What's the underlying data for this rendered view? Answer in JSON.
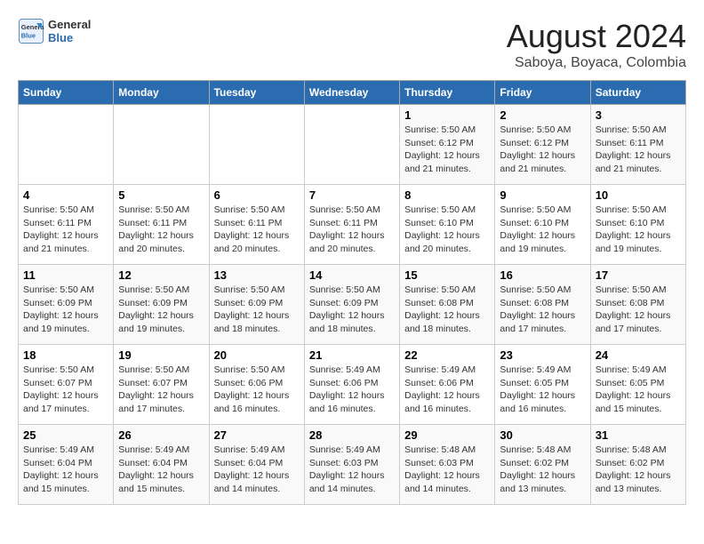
{
  "logo": {
    "line1": "General",
    "line2": "Blue"
  },
  "title": "August 2024",
  "subtitle": "Saboya, Boyaca, Colombia",
  "days_of_week": [
    "Sunday",
    "Monday",
    "Tuesday",
    "Wednesday",
    "Thursday",
    "Friday",
    "Saturday"
  ],
  "weeks": [
    [
      {
        "day": "",
        "info": ""
      },
      {
        "day": "",
        "info": ""
      },
      {
        "day": "",
        "info": ""
      },
      {
        "day": "",
        "info": ""
      },
      {
        "day": "1",
        "info": "Sunrise: 5:50 AM\nSunset: 6:12 PM\nDaylight: 12 hours\nand 21 minutes."
      },
      {
        "day": "2",
        "info": "Sunrise: 5:50 AM\nSunset: 6:12 PM\nDaylight: 12 hours\nand 21 minutes."
      },
      {
        "day": "3",
        "info": "Sunrise: 5:50 AM\nSunset: 6:11 PM\nDaylight: 12 hours\nand 21 minutes."
      }
    ],
    [
      {
        "day": "4",
        "info": "Sunrise: 5:50 AM\nSunset: 6:11 PM\nDaylight: 12 hours\nand 21 minutes."
      },
      {
        "day": "5",
        "info": "Sunrise: 5:50 AM\nSunset: 6:11 PM\nDaylight: 12 hours\nand 20 minutes."
      },
      {
        "day": "6",
        "info": "Sunrise: 5:50 AM\nSunset: 6:11 PM\nDaylight: 12 hours\nand 20 minutes."
      },
      {
        "day": "7",
        "info": "Sunrise: 5:50 AM\nSunset: 6:11 PM\nDaylight: 12 hours\nand 20 minutes."
      },
      {
        "day": "8",
        "info": "Sunrise: 5:50 AM\nSunset: 6:10 PM\nDaylight: 12 hours\nand 20 minutes."
      },
      {
        "day": "9",
        "info": "Sunrise: 5:50 AM\nSunset: 6:10 PM\nDaylight: 12 hours\nand 19 minutes."
      },
      {
        "day": "10",
        "info": "Sunrise: 5:50 AM\nSunset: 6:10 PM\nDaylight: 12 hours\nand 19 minutes."
      }
    ],
    [
      {
        "day": "11",
        "info": "Sunrise: 5:50 AM\nSunset: 6:09 PM\nDaylight: 12 hours\nand 19 minutes."
      },
      {
        "day": "12",
        "info": "Sunrise: 5:50 AM\nSunset: 6:09 PM\nDaylight: 12 hours\nand 19 minutes."
      },
      {
        "day": "13",
        "info": "Sunrise: 5:50 AM\nSunset: 6:09 PM\nDaylight: 12 hours\nand 18 minutes."
      },
      {
        "day": "14",
        "info": "Sunrise: 5:50 AM\nSunset: 6:09 PM\nDaylight: 12 hours\nand 18 minutes."
      },
      {
        "day": "15",
        "info": "Sunrise: 5:50 AM\nSunset: 6:08 PM\nDaylight: 12 hours\nand 18 minutes."
      },
      {
        "day": "16",
        "info": "Sunrise: 5:50 AM\nSunset: 6:08 PM\nDaylight: 12 hours\nand 17 minutes."
      },
      {
        "day": "17",
        "info": "Sunrise: 5:50 AM\nSunset: 6:08 PM\nDaylight: 12 hours\nand 17 minutes."
      }
    ],
    [
      {
        "day": "18",
        "info": "Sunrise: 5:50 AM\nSunset: 6:07 PM\nDaylight: 12 hours\nand 17 minutes."
      },
      {
        "day": "19",
        "info": "Sunrise: 5:50 AM\nSunset: 6:07 PM\nDaylight: 12 hours\nand 17 minutes."
      },
      {
        "day": "20",
        "info": "Sunrise: 5:50 AM\nSunset: 6:06 PM\nDaylight: 12 hours\nand 16 minutes."
      },
      {
        "day": "21",
        "info": "Sunrise: 5:49 AM\nSunset: 6:06 PM\nDaylight: 12 hours\nand 16 minutes."
      },
      {
        "day": "22",
        "info": "Sunrise: 5:49 AM\nSunset: 6:06 PM\nDaylight: 12 hours\nand 16 minutes."
      },
      {
        "day": "23",
        "info": "Sunrise: 5:49 AM\nSunset: 6:05 PM\nDaylight: 12 hours\nand 16 minutes."
      },
      {
        "day": "24",
        "info": "Sunrise: 5:49 AM\nSunset: 6:05 PM\nDaylight: 12 hours\nand 15 minutes."
      }
    ],
    [
      {
        "day": "25",
        "info": "Sunrise: 5:49 AM\nSunset: 6:04 PM\nDaylight: 12 hours\nand 15 minutes."
      },
      {
        "day": "26",
        "info": "Sunrise: 5:49 AM\nSunset: 6:04 PM\nDaylight: 12 hours\nand 15 minutes."
      },
      {
        "day": "27",
        "info": "Sunrise: 5:49 AM\nSunset: 6:04 PM\nDaylight: 12 hours\nand 14 minutes."
      },
      {
        "day": "28",
        "info": "Sunrise: 5:49 AM\nSunset: 6:03 PM\nDaylight: 12 hours\nand 14 minutes."
      },
      {
        "day": "29",
        "info": "Sunrise: 5:48 AM\nSunset: 6:03 PM\nDaylight: 12 hours\nand 14 minutes."
      },
      {
        "day": "30",
        "info": "Sunrise: 5:48 AM\nSunset: 6:02 PM\nDaylight: 12 hours\nand 13 minutes."
      },
      {
        "day": "31",
        "info": "Sunrise: 5:48 AM\nSunset: 6:02 PM\nDaylight: 12 hours\nand 13 minutes."
      }
    ]
  ]
}
